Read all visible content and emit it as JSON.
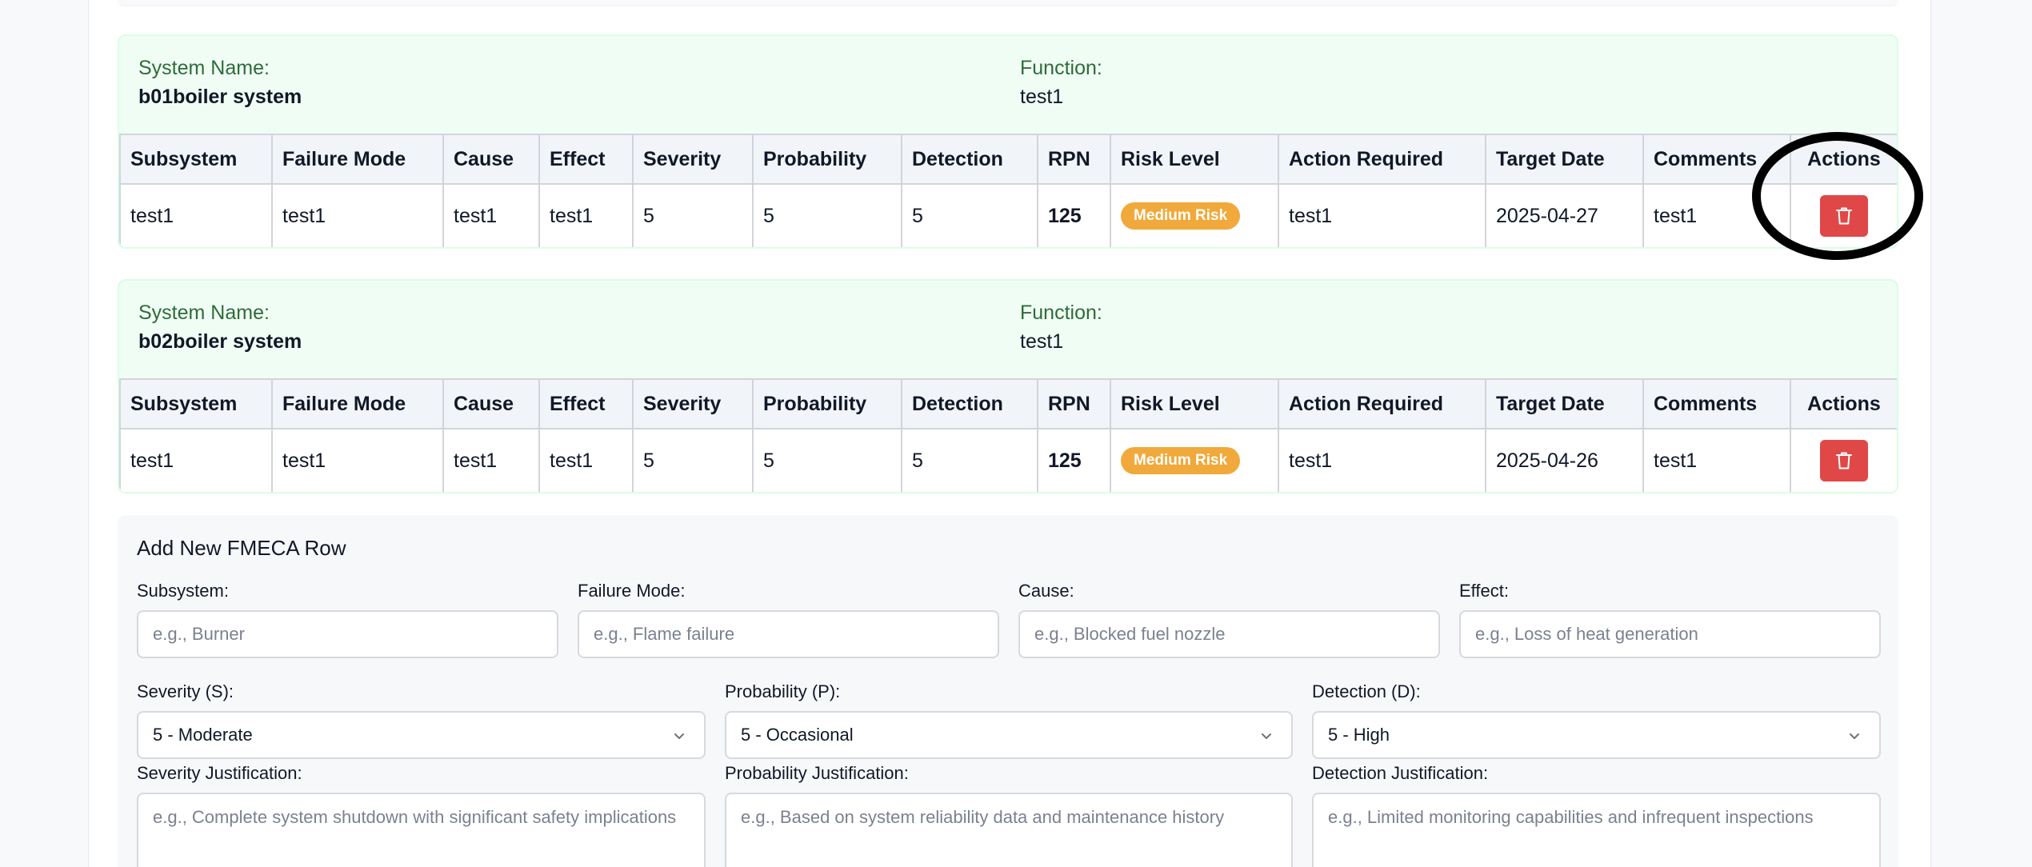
{
  "table_headers": [
    "Subsystem",
    "Failure Mode",
    "Cause",
    "Effect",
    "Severity",
    "Probability",
    "Detection",
    "RPN",
    "Risk Level",
    "Action Required",
    "Target Date",
    "Comments",
    "Actions"
  ],
  "system_name_label": "System Name:",
  "function_label": "Function:",
  "systems": [
    {
      "name": "b01boiler system",
      "function": "test1",
      "row": {
        "subsystem": "test1",
        "failure_mode": "test1",
        "cause": "test1",
        "effect": "test1",
        "severity": "5",
        "probability": "5",
        "detection": "5",
        "rpn": "125",
        "risk_level": "Medium Risk",
        "action_required": "test1",
        "target_date": "2025-04-27",
        "comments": "test1"
      }
    },
    {
      "name": "b02boiler system",
      "function": "test1",
      "row": {
        "subsystem": "test1",
        "failure_mode": "test1",
        "cause": "test1",
        "effect": "test1",
        "severity": "5",
        "probability": "5",
        "detection": "5",
        "rpn": "125",
        "risk_level": "Medium Risk",
        "action_required": "test1",
        "target_date": "2025-04-26",
        "comments": "test1"
      }
    }
  ],
  "form": {
    "title": "Add New FMECA Row",
    "subsystem_label": "Subsystem:",
    "subsystem_placeholder": "e.g., Burner",
    "failure_mode_label": "Failure Mode:",
    "failure_mode_placeholder": "e.g., Flame failure",
    "cause_label": "Cause:",
    "cause_placeholder": "e.g., Blocked fuel nozzle",
    "effect_label": "Effect:",
    "effect_placeholder": "e.g., Loss of heat generation",
    "severity_label": "Severity (S):",
    "severity_value": "5 - Moderate",
    "probability_label": "Probability (P):",
    "probability_value": "5 - Occasional",
    "detection_label": "Detection (D):",
    "detection_value": "5 - High",
    "severity_just_label": "Severity Justification:",
    "severity_just_placeholder": "e.g., Complete system shutdown with significant safety implications",
    "probability_just_label": "Probability Justification:",
    "probability_just_placeholder": "e.g., Based on system reliability data and maintenance history",
    "detection_just_label": "Detection Justification:",
    "detection_just_placeholder": "e.g., Limited monitoring capabilities and infrequent inspections"
  },
  "colors": {
    "card_bg": "#f0fdf4",
    "rpn": "#d97706",
    "risk_badge": "#f0a93a",
    "delete_button": "#e04848"
  },
  "icons": {
    "delete": "trash-icon",
    "select": "chevron-down-icon"
  }
}
